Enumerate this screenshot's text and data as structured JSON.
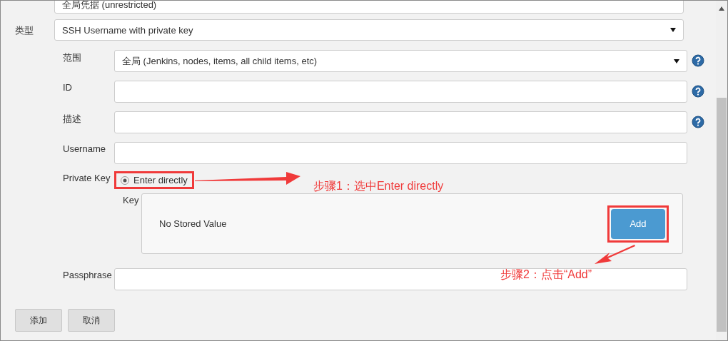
{
  "top_field": {
    "value": "全局凭据 (unrestricted)"
  },
  "kind_row": {
    "label": "类型",
    "value": "SSH Username with private key"
  },
  "fields": [
    {
      "label": "范围",
      "kind": "select",
      "value": "全局 (Jenkins, nodes, items, all child items, etc)",
      "help": true
    },
    {
      "label": "ID",
      "kind": "text",
      "help": true
    },
    {
      "label": "描述",
      "kind": "text",
      "help": true
    },
    {
      "label": "Username",
      "kind": "text",
      "help": false
    }
  ],
  "private_key": {
    "label": "Private Key",
    "option": {
      "label": "Enter directly",
      "selected": true
    },
    "key_label": "Key",
    "stored": "No Stored Value",
    "add": "Add"
  },
  "passphrase": {
    "label": "Passphrase"
  },
  "buttons": [
    "添加",
    "取消"
  ],
  "annotations": [
    {
      "text": "步骤1：选中Enter directly"
    },
    {
      "text": "步骤2：点击“Add”"
    }
  ]
}
